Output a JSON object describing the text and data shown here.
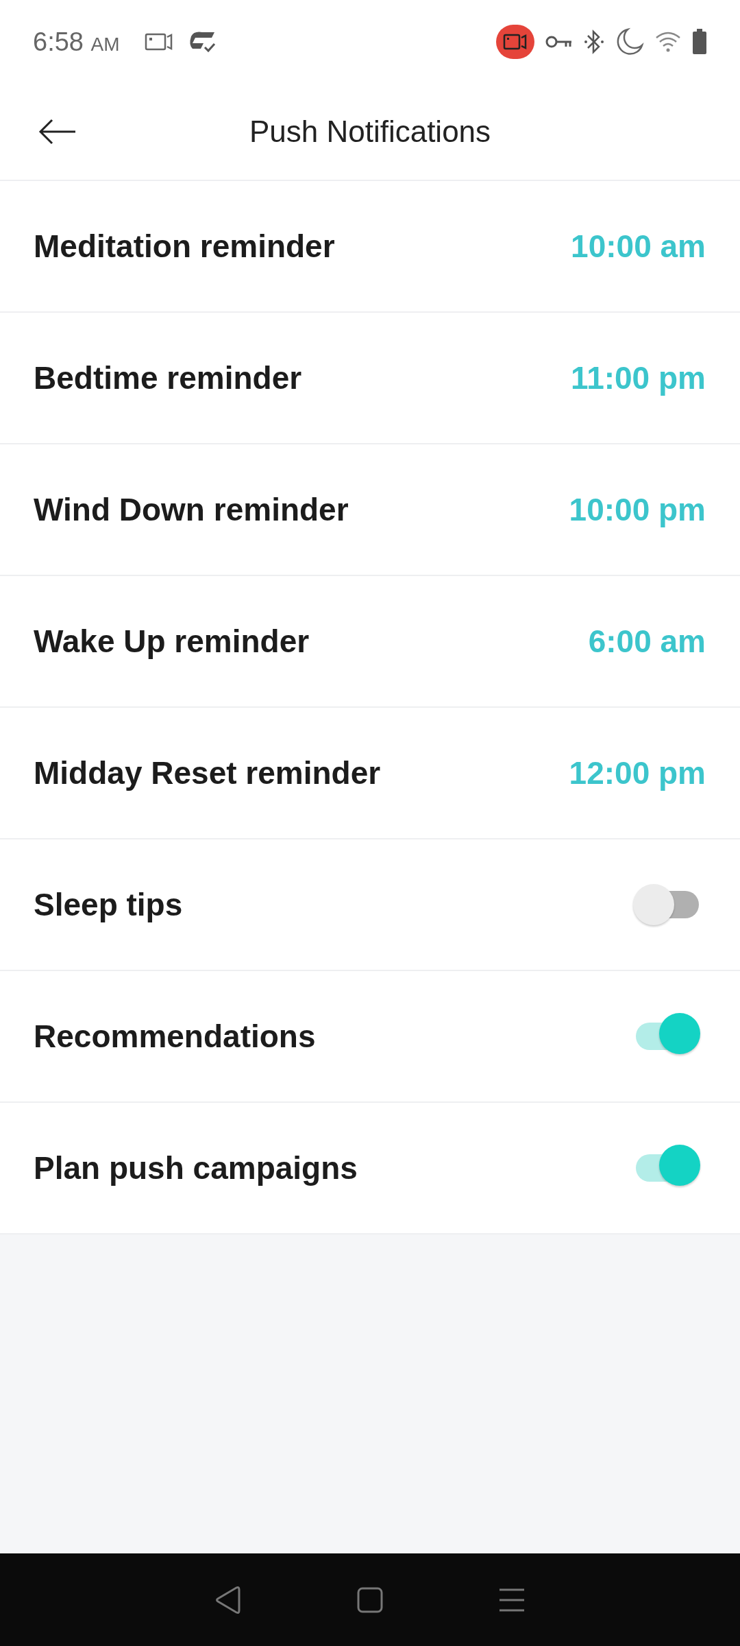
{
  "status_bar": {
    "time": "6:58",
    "meridiem": "AM"
  },
  "header": {
    "title": "Push Notifications"
  },
  "settings": [
    {
      "kind": "time",
      "label": "Meditation reminder",
      "value": "10:00 am"
    },
    {
      "kind": "time",
      "label": "Bedtime reminder",
      "value": "11:00 pm"
    },
    {
      "kind": "time",
      "label": "Wind Down reminder",
      "value": "10:00 pm"
    },
    {
      "kind": "time",
      "label": "Wake Up reminder",
      "value": "6:00 am"
    },
    {
      "kind": "time",
      "label": "Midday Reset reminder",
      "value": "12:00 pm"
    },
    {
      "kind": "toggle",
      "label": "Sleep tips",
      "on": false
    },
    {
      "kind": "toggle",
      "label": "Recommendations",
      "on": true
    },
    {
      "kind": "toggle",
      "label": "Plan push campaigns",
      "on": true
    }
  ]
}
